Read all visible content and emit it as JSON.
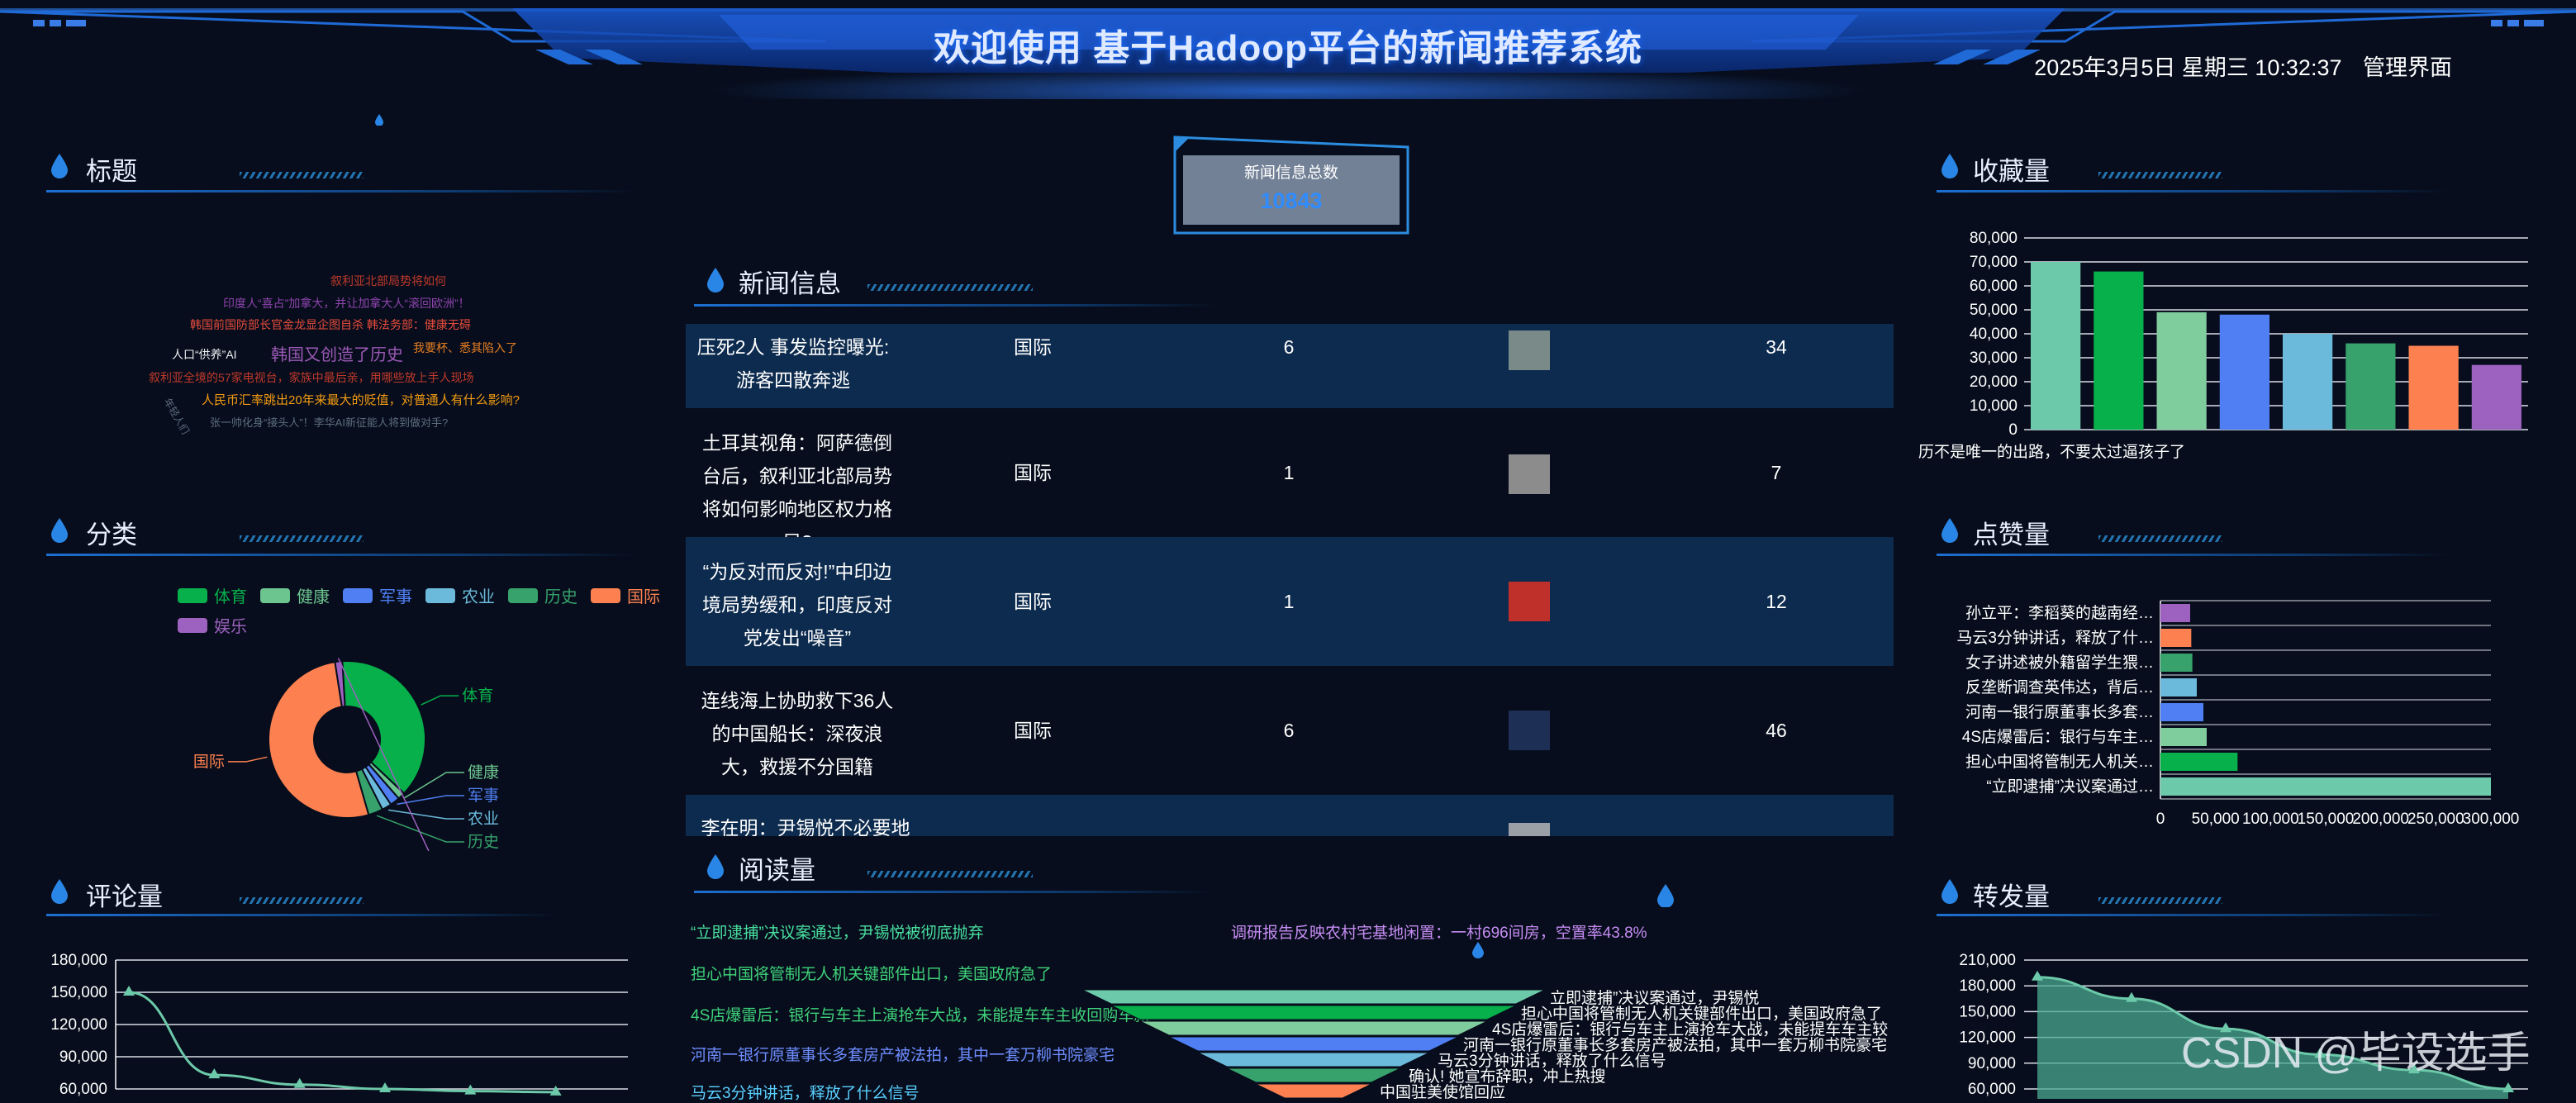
{
  "header": {
    "title": "欢迎使用 基于Hadoop平台的新闻推荐系统",
    "datetime": "2025年3月5日 星期三 10:32:37",
    "admin_link": "管理界面"
  },
  "panels": {
    "title_panel": "标题",
    "category_panel": "分类",
    "comment_panel": "评论量",
    "news_panel": "新闻信息",
    "reading_panel": "阅读量",
    "favorite_panel": "收藏量",
    "like_panel": "点赞量",
    "forward_panel": "转发量"
  },
  "total": {
    "label": "新闻信息总数",
    "value": "10843"
  },
  "word_cloud": [
    {
      "text": "叙利亚北部局势将如何",
      "color": "#c0392b"
    },
    {
      "text": "印度人“喜占”加拿大，并让加拿大人“滚回欧洲”！",
      "color": "#8e44ad"
    },
    {
      "text": "韩国前国防部长官金龙显企图自杀 韩法务部：健康无碍",
      "color": "#e74c3c"
    },
    {
      "text": "人口“供养”AI",
      "color": "#ecf0f1"
    },
    {
      "text": "韩国又创造了历史",
      "color": "#9b59b6"
    },
    {
      "text": "我要杯、悉其陷入了",
      "color": "#e67e22"
    },
    {
      "text": "叙利亚全境的57家电视台，家族中最后亲，用哪些放上手人现场",
      "color": "#c0392b"
    },
    {
      "text": "人民币汇率跳出20年来最大的贬值，对普通人有什么影响?",
      "color": "#f39c12"
    },
    {
      "text": "张一帅化身“接头人”！李华AI新征能人将到做对手?",
      "color": "#5d6d7e"
    },
    {
      "text": "年轻人们",
      "color": "#5d6d7e"
    }
  ],
  "category_legend": [
    {
      "name": "体育",
      "color": "#07b04b"
    },
    {
      "name": "健康",
      "color": "#6cc48f"
    },
    {
      "name": "军事",
      "color": "#4f7ff2"
    },
    {
      "name": "农业",
      "color": "#6cbadb"
    },
    {
      "name": "历史",
      "color": "#37a26b"
    },
    {
      "name": "国际",
      "color": "#fd8150"
    },
    {
      "name": "娱乐",
      "color": "#9d62bf"
    }
  ],
  "news_rows": [
    {
      "title": "压死2人 事发监控曝光: 游客四散奔逃",
      "category": "国际",
      "count": "6",
      "thumb_color": "#7a8a88",
      "value": "34"
    },
    {
      "title": "土耳其视角：阿萨德倒台后，叙利亚北部局势将如何影响地区权力格局?",
      "category": "国际",
      "count": "1",
      "thumb_color": "#8c8c8c",
      "value": "7"
    },
    {
      "title": "“为反对而反对!”中印边境局势缓和，印度反对党发出“噪音”",
      "category": "国际",
      "count": "1",
      "thumb_color": "#c0302a",
      "value": "12"
    },
    {
      "title": "连线海上协助救下36人的中国船长：深夜浪大，救援不分国籍",
      "category": "国际",
      "count": "6",
      "thumb_color": "#1d2f55",
      "value": "46"
    },
    {
      "title": "李在明：尹锡悦不必要地",
      "category": "",
      "count": "",
      "thumb_color": "#9aa0a6",
      "value": ""
    }
  ],
  "reading_ticker": [
    {
      "text": "“立即逮捕”决议案通过，尹锡悦被彻底抛弃",
      "color": "#49e0a0"
    },
    {
      "text": "调研报告反映农村宅基地闲置：一村696间房，空置率43.8%",
      "color": "#c58cf2"
    },
    {
      "text": "担心中国将管制无人机关键部件出口，美国政府急了",
      "color": "#3fd27a"
    },
    {
      "text": "4S店爆雷后：银行与车主上演抢车大战，未能提车车主收回购车款",
      "color": "#3fd27a"
    },
    {
      "text": "河南一银行原董事长多套房产被法拍，其中一套万柳书院豪宅",
      "color": "#6e8dff"
    },
    {
      "text": "马云3分钟讲话，释放了什么信号",
      "color": "#5ad0ff"
    },
    {
      "text": "中国驻美使馆回应",
      "color": "#e7b74b"
    }
  ],
  "funnel_labels": [
    {
      "text": "立即逮捕”决议案通过，尹锡悦",
      "color": "#ffffff"
    },
    {
      "text": "担心中国将管制无人机关键部件出口，美国政府急了",
      "color": "#4ddc8c"
    },
    {
      "text": "4S店爆雷后：银行与车主上演抢车大战，未能提车车主较",
      "color": "#ffffff"
    },
    {
      "text": "河南一银行原董事长多套房产被法拍，其中一套万柳书院豪宅",
      "color": "#8aa2ff"
    },
    {
      "text": "马云3分钟讲话，释放了什么信号",
      "color": "#ffffff"
    },
    {
      "text": "确认! 她宣布辞职，冲上热搜",
      "color": "#ffffff"
    },
    {
      "text": "中国驻美使馆回应",
      "color": "#e7b74b"
    }
  ],
  "favorite_caption": "历不是唯一的出路，不要太过逼孩子了",
  "watermark": "CSDN @毕设选手",
  "chart_data": [
    {
      "type": "bar",
      "name": "收藏量",
      "values": [
        70000,
        66000,
        49000,
        48000,
        40000,
        36000,
        35000,
        27000
      ],
      "colors": [
        "#6cc9a9",
        "#07b04b",
        "#7fcc9c",
        "#4f7ff2",
        "#6cbadb",
        "#37a26b",
        "#fd8150",
        "#9d62bf"
      ],
      "ylim": [
        0,
        80000
      ],
      "yticks": [
        "0",
        "10,000",
        "20,000",
        "30,000",
        "40,000",
        "50,000",
        "60,000",
        "70,000",
        "80,000"
      ]
    },
    {
      "type": "bar",
      "name": "点赞量",
      "orientation": "horizontal",
      "categories": [
        "孙立平：李稻葵的越南经…",
        "马云3分钟讲话，释放了什…",
        "女子讲述被外籍留学生猥…",
        "反垄断调查英伟达，背后…",
        "河南一银行原董事长多套…",
        "4S店爆雷后：银行与车主…",
        "担心中国将管制无人机关…",
        "“立即逮捕”决议案通过…"
      ],
      "values": [
        27000,
        28000,
        29000,
        33000,
        39000,
        42000,
        70000,
        300000
      ],
      "colors": [
        "#9d62bf",
        "#fd8150",
        "#37a26b",
        "#6cbadb",
        "#4f7ff2",
        "#7fcc9c",
        "#07b04b",
        "#6cc9a9"
      ],
      "xlim": [
        0,
        300000
      ],
      "xticks": [
        "0",
        "50,000",
        "100,000",
        "150,000",
        "200,000",
        "250,000",
        "300,000"
      ]
    },
    {
      "type": "pie",
      "name": "分类",
      "categories": [
        "体育",
        "健康",
        "军事",
        "农业",
        "历史",
        "国际",
        "娱乐"
      ],
      "values": [
        38,
        1.5,
        2,
        2,
        3,
        52,
        1.5
      ],
      "colors": [
        "#07b04b",
        "#6cc48f",
        "#4f7ff2",
        "#6cbadb",
        "#37a26b",
        "#fd8150",
        "#9d62bf"
      ]
    },
    {
      "type": "line",
      "name": "评论量",
      "values": [
        150000,
        73000,
        64000,
        60000,
        58000,
        57000
      ],
      "ylim": [
        60000,
        180000
      ],
      "yticks": [
        "60,000",
        "90,000",
        "120,000",
        "150,000",
        "180,000"
      ]
    },
    {
      "type": "area",
      "name": "转发量",
      "values": [
        190000,
        165000,
        130000,
        100000,
        82000,
        60000
      ],
      "ylim": [
        60000,
        210000
      ],
      "yticks": [
        "60,000",
        "90,000",
        "120,000",
        "150,000",
        "180,000",
        "210,000"
      ]
    }
  ]
}
